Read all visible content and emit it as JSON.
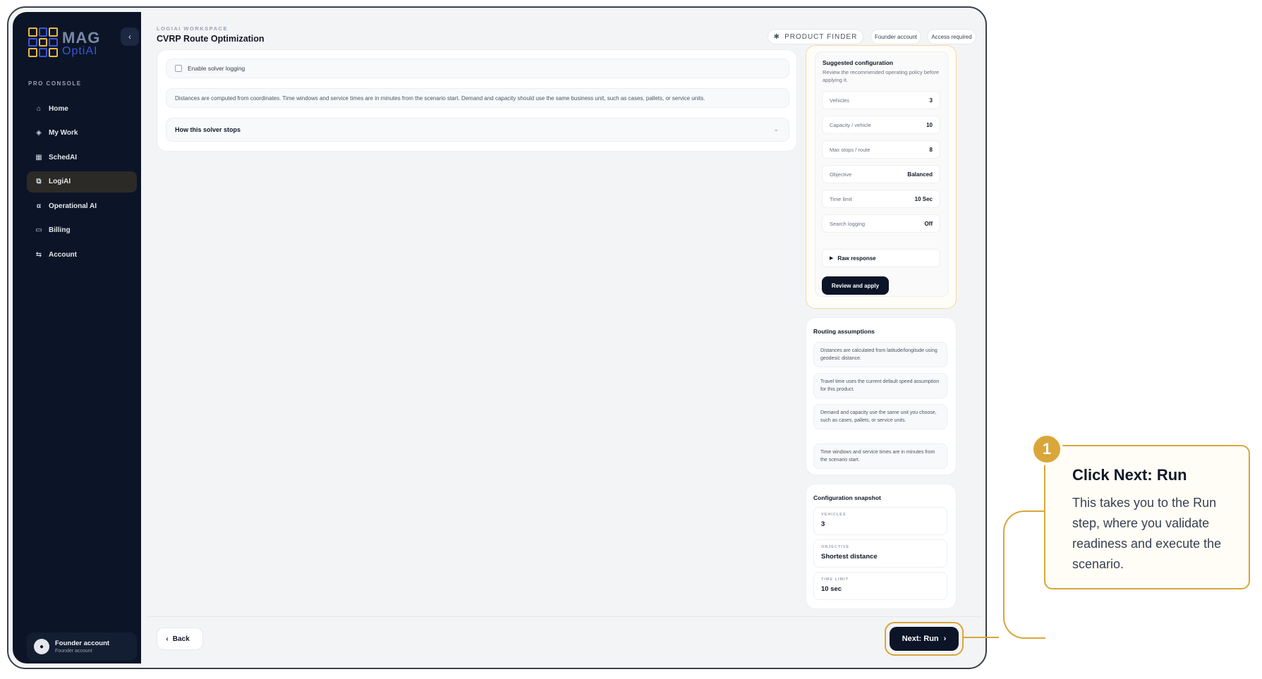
{
  "brand": {
    "name_top": "MAG",
    "name_bottom": "OptiAI"
  },
  "sidebar": {
    "section_label": "PRO CONSOLE",
    "collapse_glyph": "‹",
    "items": [
      {
        "label": "Home",
        "icon": "⌂",
        "active": false
      },
      {
        "label": "My Work",
        "icon": "◈",
        "active": false
      },
      {
        "label": "SchedAI",
        "icon": "▦",
        "active": false
      },
      {
        "label": "LogiAI",
        "icon": "⧉",
        "active": true
      },
      {
        "label": "Operational AI",
        "icon": "α",
        "active": false
      },
      {
        "label": "Billing",
        "icon": "▭",
        "active": false
      },
      {
        "label": "Account",
        "icon": "⇆",
        "active": false
      }
    ],
    "user": {
      "name": "Founder account",
      "subtitle": "Founder account",
      "avatar_glyph": "●"
    }
  },
  "header": {
    "breadcrumb": "LOGIAI WORKSPACE",
    "title": "CVRP Route Optimization",
    "product_finder": "PRODUCT FINDER",
    "product_finder_icon": "✱",
    "account_pill": "Founder account",
    "access_pill": "Access required"
  },
  "main": {
    "solver_logging_label": "Enable solver logging",
    "units_note": "Distances are computed from coordinates. Time windows and service times are in minutes from the scenario start. Demand and capacity should use the same business unit, such as cases, pallets, or service units.",
    "solver_stops_label": "How this solver stops",
    "chevron": "⌄"
  },
  "suggested": {
    "title": "Suggested configuration",
    "description": "Review the recommended operating policy before applying it.",
    "rows": [
      {
        "key": "Vehicles",
        "value": "3"
      },
      {
        "key": "Capacity / vehicle",
        "value": "10"
      },
      {
        "key": "Max stops / route",
        "value": "8"
      },
      {
        "key": "Objective",
        "value": "Balanced"
      },
      {
        "key": "Time limit",
        "value": "10 Sec"
      },
      {
        "key": "Search logging",
        "value": "Off"
      }
    ],
    "raw_response": "Raw response",
    "apply_button": "Review and apply"
  },
  "routing": {
    "title": "Routing assumptions",
    "notes": [
      "Distances are calculated from latitude/longitude using geodesic distance.",
      "Travel time uses the current default speed assumption for this product.",
      "Demand and capacity use the same unit you choose, such as cases, pallets, or service units.",
      "Time windows and service times are in minutes from the scenario start."
    ]
  },
  "snapshot": {
    "title": "Configuration snapshot",
    "items": [
      {
        "label": "VEHICLES",
        "value": "3"
      },
      {
        "label": "OBJECTIVE",
        "value": "Shortest distance"
      },
      {
        "label": "TIME LIMIT",
        "value": "10 sec"
      }
    ]
  },
  "footer": {
    "back_label": "Back",
    "back_glyph": "‹",
    "next_label": "Next: Run",
    "next_glyph": "›"
  },
  "callout": {
    "step": "1",
    "title": "Click Next: Run",
    "body": "This takes you to the Run step, where you validate readiness and execute the scenario."
  },
  "colors": {
    "accent": "#d9a63a",
    "navy": "#0c1527",
    "brand_blue": "#3a56d8"
  }
}
